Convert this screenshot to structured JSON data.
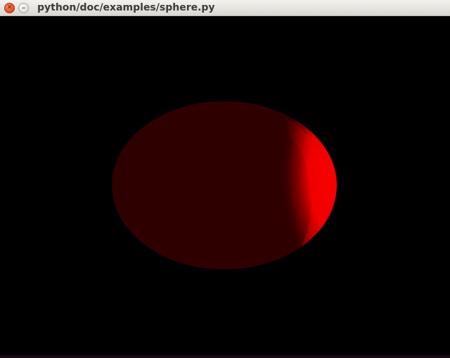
{
  "window": {
    "title": "python/doc/examples/sphere.py",
    "close_icon_glyph": "✕",
    "minimize_icon_glyph": "–"
  },
  "scene": {
    "background_color": "#000000",
    "sphere_dark_color": "#2e0000",
    "sphere_lit_color": "#ff0000"
  }
}
